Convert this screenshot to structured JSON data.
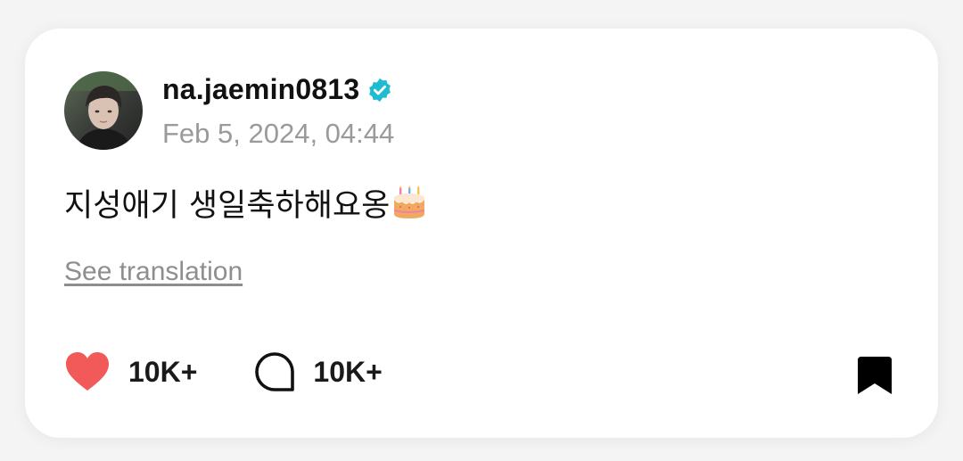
{
  "post": {
    "username": "na.jaemin0813",
    "verified": true,
    "timestamp": "Feb 5, 2024, 04:44",
    "text": "지성애기 생일축하해요옹",
    "emoji": "birthday-cake",
    "translate_link": "See translation"
  },
  "actions": {
    "likes": "10K+",
    "comments": "10K+"
  },
  "colors": {
    "like": "#f25a5a",
    "verified": "#1fbcd1",
    "text": "#111111",
    "muted": "#9a9a9a"
  },
  "icons": {
    "like": "heart-icon",
    "comment": "comment-bubble-icon",
    "bookmark": "bookmark-icon",
    "verified": "verified-badge-icon"
  }
}
